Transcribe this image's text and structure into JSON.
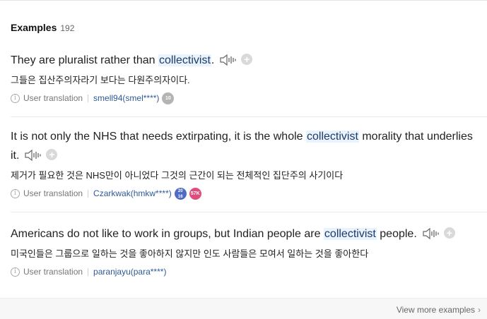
{
  "header": {
    "title": "Examples",
    "count": "192"
  },
  "examples": [
    {
      "en_before": "They are pluralist rather than ",
      "keyword": "collectivist",
      "en_after": ".",
      "ko": "그들은 집산주의자라기 보다는 다원주의자이다.",
      "source": "User translation",
      "user": "smell94(smel****)",
      "badges": [
        "10"
      ]
    },
    {
      "en_before": "It is not only the NHS that needs extirpating, it is the whole ",
      "keyword": "collectivist",
      "en_after": " morality that underlies it.",
      "ko": "제거가 필요한 것은 NHS만이 아니었다 그것의 근간이 되는 전체적인 집단주의 사기이다",
      "source": "User translation",
      "user": "Czarkwak(hmkw****)",
      "badges": [
        "20\n16",
        "57K"
      ]
    },
    {
      "en_before": "Americans do not like to work in groups, but Indian people are ",
      "keyword": "collectivist",
      "en_after": " people.",
      "ko": "미국인들은 그룹으로 일하는 것을 좋아하지 않지만 인도 사람들은 모여서 일하는 것을 좋아한다",
      "source": "User translation",
      "user": "paranjayu(para****)",
      "badges": []
    }
  ],
  "footer": {
    "more_label": "View more examples"
  },
  "icons": {
    "speaker": "speaker-icon",
    "add": "plus-icon",
    "info": "info-icon",
    "chevron": "chevron-right-icon"
  },
  "colors": {
    "highlight": "#e8f3fd",
    "user_link": "#2e5a96",
    "badge_blue": "#4f6cc7",
    "badge_pink": "#df4d7c",
    "badge_gray": "#b4b4b4"
  }
}
